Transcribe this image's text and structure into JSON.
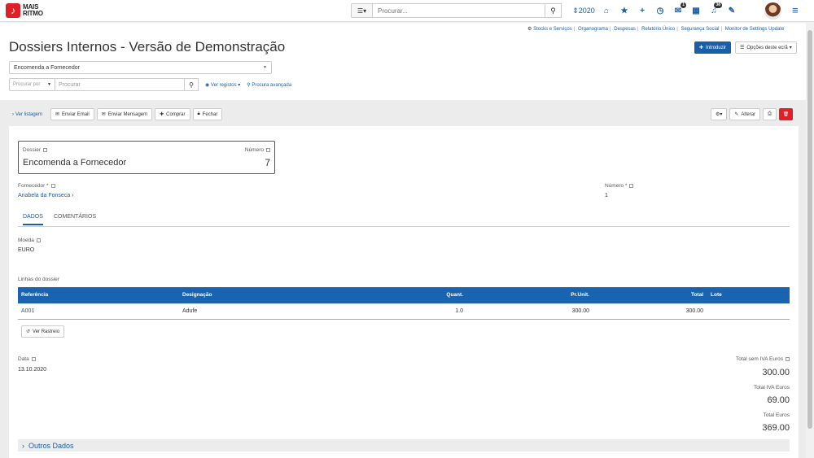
{
  "topbar": {
    "logo_line1": "MAIS",
    "logo_line2": "RITMO",
    "search_placeholder": "Procurar...",
    "year": "2020",
    "badges": {
      "notifications": "1",
      "bell": "38"
    }
  },
  "links": [
    "Stocks e Serviços",
    "Organograma",
    "Despesas",
    "Relatório Único",
    "Segurança Social",
    "Monitor de Settings Update"
  ],
  "page": {
    "title": "Dossiers Internos - Versão de Demonstração",
    "introduzir": "Introduzir",
    "opcoes": "Opções deste ecrã",
    "doc_type": "Encomenda a Fornecedor",
    "procurar_por": "Procurar por",
    "procurar": "Procurar",
    "ver_registos": "Ver registos",
    "procura_avancada": "Procura avançada"
  },
  "toolbar": {
    "ver_listagem": "Ver listagem",
    "enviar_email": "Enviar Email",
    "enviar_mensagem": "Enviar Mensagem",
    "comprar": "Comprar",
    "fechar": "Fechar",
    "alterar": "Alterar"
  },
  "dossier": {
    "label_dossier": "Dossier",
    "label_numero": "Número",
    "dossier_value": "Encomenda a Fornecedor",
    "numero_value": "7",
    "label_fornecedor": "Fornecedor *",
    "fornecedor_value": "Anabela da Fonseca",
    "label_numero2": "Número *",
    "numero2_value": "1"
  },
  "tabs": [
    "DADOS",
    "COMENTÁRIOS"
  ],
  "dados": {
    "label_moeda": "Moeda",
    "moeda_value": "EURO",
    "linhas_label": "Linhas do dossier"
  },
  "table": {
    "headers": [
      "Referência",
      "Designação",
      "Quant.",
      "Pr.Unit.",
      "Total",
      "Lote"
    ],
    "rows": [
      [
        "A001",
        "Adufe",
        "1.0",
        "300.00",
        "300.00",
        ""
      ]
    ]
  },
  "ver_rastreio": "Ver Rastreio",
  "footer": {
    "label_data": "Data",
    "data_value": "13.10.2020",
    "label_total_sem_iva": "Total sem IVA Euros",
    "total_sem_iva": "300.00",
    "label_total_iva": "Total IVA Euros",
    "total_iva": "69.00",
    "label_total": "Total Euros",
    "total": "369.00"
  },
  "outros_dados": "Outros Dados",
  "colors": {
    "accent": "#1a5fa6",
    "header": "#1a63b0",
    "danger": "#e01f26"
  }
}
